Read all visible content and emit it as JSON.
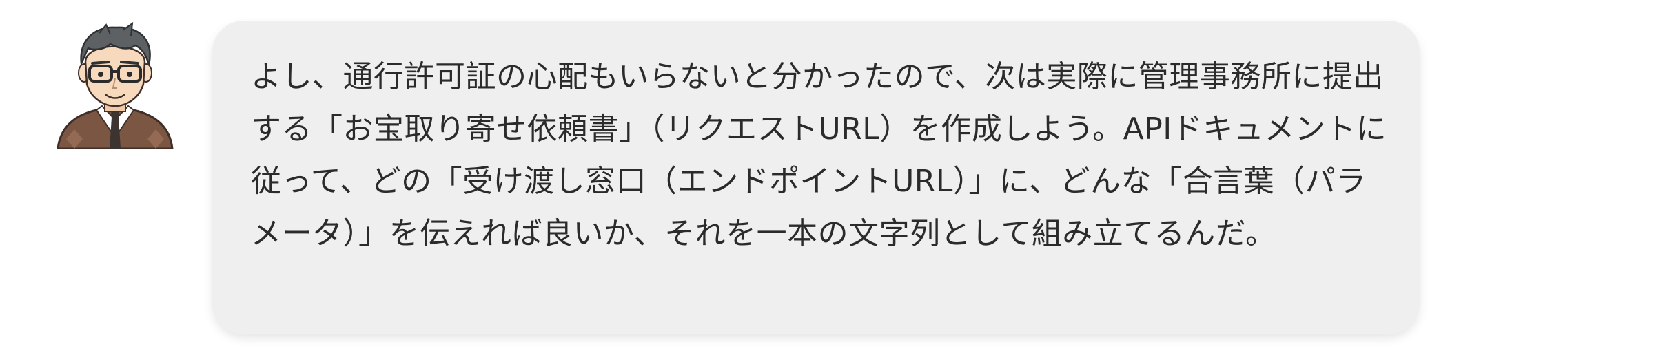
{
  "chat": {
    "avatar": {
      "icon": "man-with-glasses-avatar-icon",
      "hair_color": "#5d6164",
      "skin_color": "#f7d9bd",
      "vest_color": "#7a5643",
      "tie_color": "#3b3430"
    },
    "bubble": {
      "background": "#efefef",
      "text_color": "#2b2b2b",
      "text": "よし、通行許可証の心配もいらないと分かったので、次は実際に管理事務所に提出する「お宝取り寄せ依頼書」（リクエストURL）を作成しよう。APIドキュメントに従って、どの「受け渡し窓口（エンドポイントURL）」に、どんな「合言葉（パラメータ）」を伝えれば良いか、それを一本の文字列として組み立てるんだ。"
    }
  }
}
